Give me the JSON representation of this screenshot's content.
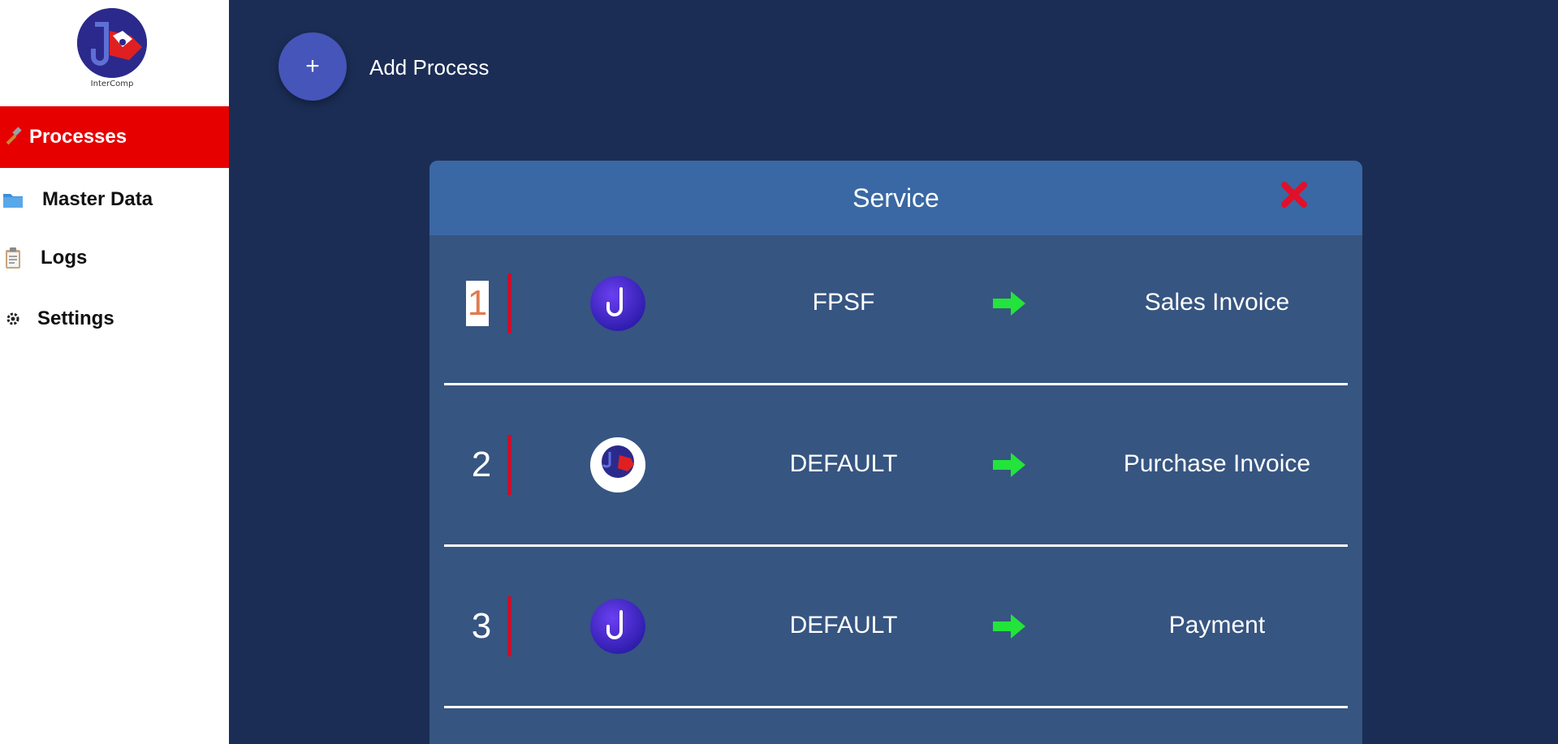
{
  "sidebar": {
    "logo_text": "InterComp",
    "items": [
      {
        "label": "Processes",
        "icon": "hammer-icon",
        "active": true
      },
      {
        "label": "Master Data",
        "icon": "folder-icon",
        "active": false
      },
      {
        "label": "Logs",
        "icon": "clipboard-icon",
        "active": false
      },
      {
        "label": "Settings",
        "icon": "gear-icon",
        "active": false
      }
    ]
  },
  "toolbar": {
    "add_icon": "+",
    "add_label": "Add Process"
  },
  "panel": {
    "title": "Service",
    "close_icon": "close-icon",
    "rows": [
      {
        "number": "1",
        "logo": "j-logo-icon",
        "source": "FPSF",
        "target": "Sales Invoice"
      },
      {
        "number": "2",
        "logo": "intercomp-logo-icon",
        "source": "DEFAULT",
        "target": "Purchase Invoice"
      },
      {
        "number": "3",
        "logo": "j-logo-icon",
        "source": "DEFAULT",
        "target": "Payment"
      }
    ]
  },
  "colors": {
    "background": "#1b2d55",
    "active_nav": "#e60000",
    "panel": "#365581",
    "panel_header": "#3a68a4",
    "arrow": "#22e43a",
    "close": "#e0102a",
    "add_button": "#4555b9"
  }
}
